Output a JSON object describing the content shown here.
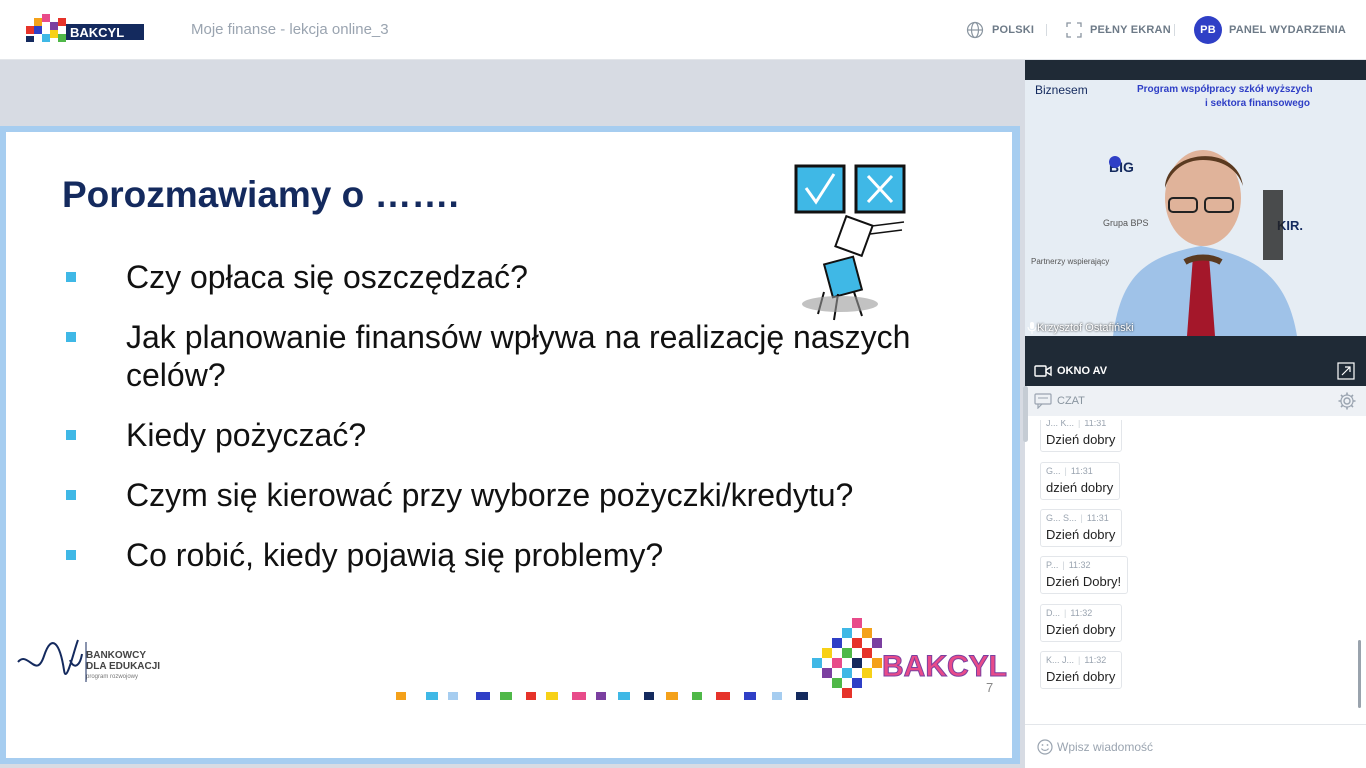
{
  "header": {
    "logo_text": "BAKCYL",
    "event_title": "Moje finanse - lekcja online_3",
    "language_label": "POLSKI",
    "fullscreen_label": "PEŁNY EKRAN",
    "avatar_initials": "PB",
    "panel_label": "PANEL WYDARZENIA"
  },
  "slide": {
    "title": "Porozmawiamy o …….",
    "bullets": [
      "Czy opłaca się oszczędzać?",
      "Jak planowanie finansów wpływa na realizację naszych celów?",
      "Kiedy pożyczać?",
      "Czym się kierować przy wyborze pożyczki/kredytu?",
      "Co robić, kiedy pojawią się problemy?"
    ],
    "partner_line1": "BANKOWCY",
    "partner_line2": "DLA EDUKACJI",
    "partner_sub": "program rozwojowy",
    "bakcyl_text": "BAKCYL",
    "page_number": "7"
  },
  "video": {
    "speaker_name": "Krzysztof Ostafiński",
    "backdrop_text1": "Biznesem",
    "backdrop_text2": "Program współpracy szkół wyższych i sektora finansowego",
    "backdrop_text3": "BIG",
    "backdrop_text4": "Grupa BPS",
    "backdrop_text5": "Partnerzy wspierający",
    "backdrop_text6": "KIR."
  },
  "av_window": {
    "label": "OKNO AV"
  },
  "chat": {
    "label": "CZAT",
    "messages": [
      {
        "author": "J... K...",
        "time": "11:31",
        "text": "Dzień dobry"
      },
      {
        "author": "G...",
        "time": "11:31",
        "text": "dzień dobry"
      },
      {
        "author": "G... S...",
        "time": "11:31",
        "text": "Dzień dobry"
      },
      {
        "author": "P...",
        "time": "11:32",
        "text": "Dzień Dobry!"
      },
      {
        "author": "D...",
        "time": "11:32",
        "text": "Dzień dobry"
      },
      {
        "author": "K... J...",
        "time": "11:32",
        "text": "Dzień dobry"
      }
    ],
    "input_placeholder": "Wpisz wiadomość"
  },
  "colors": {
    "slide_title": "#142a5e",
    "bullet": "#3fb8e6",
    "avatar": "#2f3fc6",
    "dark_bar": "#1f2a36"
  }
}
